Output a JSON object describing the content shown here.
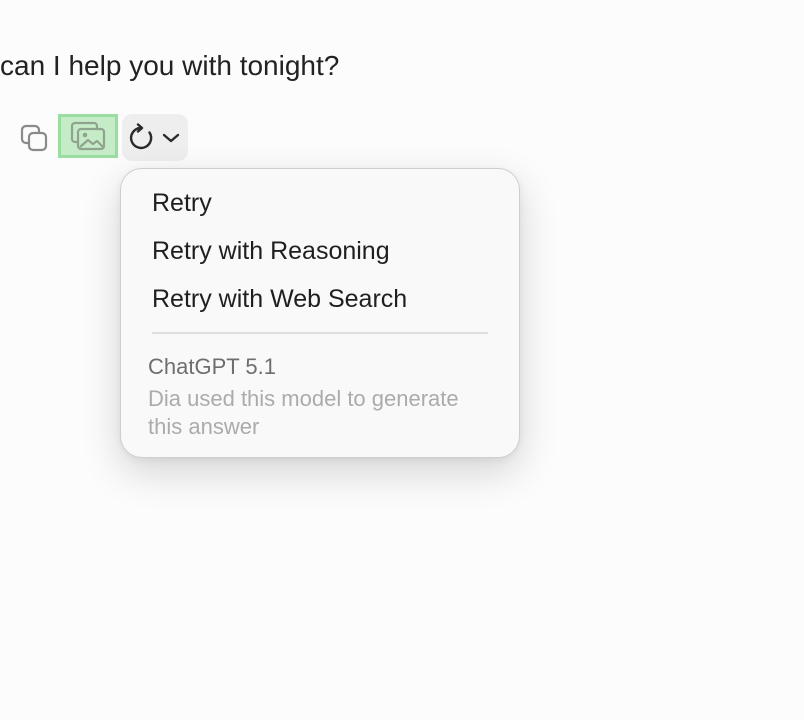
{
  "message": {
    "text": "can I help you with tonight?"
  },
  "actions": {
    "copy_icon": "copy-icon",
    "image_icon": "image-icon",
    "retry_icon": "refresh-icon",
    "chevron_icon": "chevron-down-icon",
    "highlight_color": "#c6ecc7"
  },
  "retry_menu": {
    "items": [
      {
        "label": "Retry"
      },
      {
        "label": "Retry with Reasoning"
      },
      {
        "label": "Retry with Web Search"
      }
    ],
    "model": {
      "name": "ChatGPT 5.1",
      "description": "Dia used this model to generate this answer"
    }
  }
}
